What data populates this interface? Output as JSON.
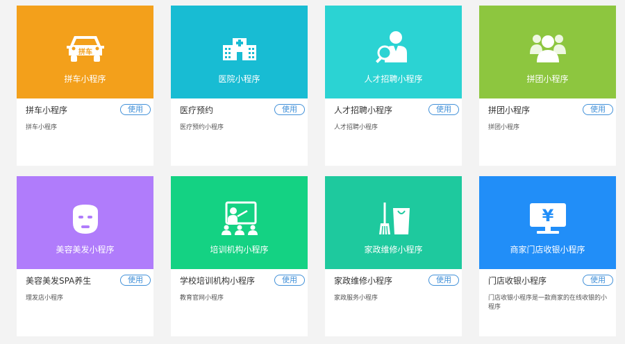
{
  "cards": [
    {
      "banner": "拼车小程序",
      "name": "拼车小程序",
      "button": "使用",
      "desc": "拼车小程序",
      "color": "#f3a01b",
      "icon": "car-icon",
      "icon_text": "拼车"
    },
    {
      "banner": "医院小程序",
      "name": "医疗预约",
      "button": "使用",
      "desc": "医疗预约小程序",
      "color": "#18bcd3",
      "icon": "hospital-icon"
    },
    {
      "banner": "人才招聘小程序",
      "name": "人才招聘小程序",
      "button": "使用",
      "desc": "人才招聘小程序",
      "color": "#2bd3d3",
      "icon": "recruiter-icon"
    },
    {
      "banner": "拼团小程序",
      "name": "拼团小程序",
      "button": "使用",
      "desc": "拼团小程序",
      "color": "#8dc63f",
      "icon": "group-icon"
    },
    {
      "banner": "美容美发小程序",
      "name": "美容美发SPA养生",
      "button": "使用",
      "desc": "理发店小程序",
      "color": "#b07cfb",
      "icon": "face-mask-icon"
    },
    {
      "banner": "培训机构小程序",
      "name": "学校培训机构小程序",
      "button": "使用",
      "desc": "教育官网小程序",
      "color": "#14d283",
      "icon": "classroom-icon"
    },
    {
      "banner": "家政维修小程序",
      "name": "家政维修小程序",
      "button": "使用",
      "desc": "家政服务小程序",
      "color": "#1ec99e",
      "icon": "cleaning-icon"
    },
    {
      "banner": "商家门店收银小程序",
      "name": "门店收银小程序",
      "button": "使用",
      "desc": "门店收银小程序是一款商家的在线收银的小程序",
      "color": "#218ef8",
      "icon": "cashier-icon",
      "icon_text": "¥"
    }
  ]
}
